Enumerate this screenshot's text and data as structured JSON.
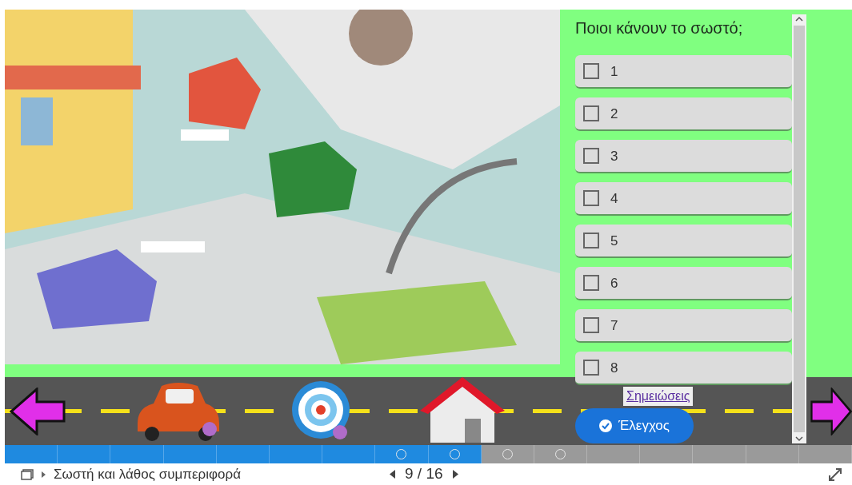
{
  "quiz": {
    "question": "Ποιοι κάνουν το σωστό;",
    "options": [
      {
        "label": "1",
        "checked": false
      },
      {
        "label": "2",
        "checked": false
      },
      {
        "label": "3",
        "checked": false
      },
      {
        "label": "4",
        "checked": false
      },
      {
        "label": "5",
        "checked": false
      },
      {
        "label": "6",
        "checked": false
      },
      {
        "label": "7",
        "checked": false
      },
      {
        "label": "8",
        "checked": false
      }
    ],
    "notes_link": "Σημειώσεις",
    "check_button": "Έλεγχος"
  },
  "progress": [
    {
      "done": true,
      "marker": false
    },
    {
      "done": true,
      "marker": false
    },
    {
      "done": true,
      "marker": false
    },
    {
      "done": true,
      "marker": false
    },
    {
      "done": true,
      "marker": false
    },
    {
      "done": true,
      "marker": false
    },
    {
      "done": true,
      "marker": false
    },
    {
      "done": true,
      "marker": true
    },
    {
      "done": true,
      "marker": true
    },
    {
      "done": false,
      "marker": true
    },
    {
      "done": false,
      "marker": true
    },
    {
      "done": false,
      "marker": false
    },
    {
      "done": false,
      "marker": false
    },
    {
      "done": false,
      "marker": false
    },
    {
      "done": false,
      "marker": false
    },
    {
      "done": false,
      "marker": false
    }
  ],
  "footer": {
    "title": "Σωστή και λάθος συμπεριφορά",
    "page": "9 / 16"
  }
}
